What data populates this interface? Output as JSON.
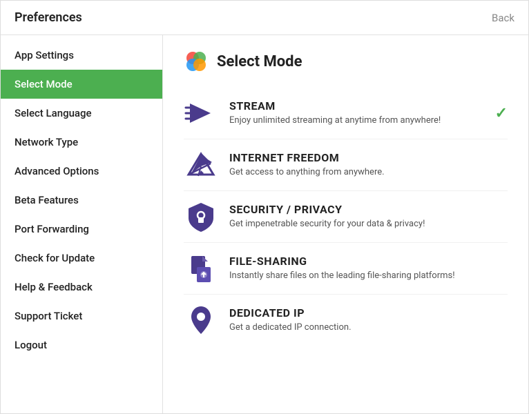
{
  "header": {
    "title": "Preferences",
    "back_label": "Back"
  },
  "sidebar": {
    "items": [
      {
        "id": "app-settings",
        "label": "App Settings",
        "active": false
      },
      {
        "id": "select-mode",
        "label": "Select Mode",
        "active": true
      },
      {
        "id": "select-language",
        "label": "Select Language",
        "active": false
      },
      {
        "id": "network-type",
        "label": "Network Type",
        "active": false
      },
      {
        "id": "advanced-options",
        "label": "Advanced Options",
        "active": false
      },
      {
        "id": "beta-features",
        "label": "Beta Features",
        "active": false
      },
      {
        "id": "port-forwarding",
        "label": "Port Forwarding",
        "active": false
      },
      {
        "id": "check-for-update",
        "label": "Check for Update",
        "active": false
      },
      {
        "id": "help-feedback",
        "label": "Help & Feedback",
        "active": false
      },
      {
        "id": "support-ticket",
        "label": "Support Ticket",
        "active": false
      },
      {
        "id": "logout",
        "label": "Logout",
        "active": false
      }
    ]
  },
  "main": {
    "title": "Select Mode",
    "modes": [
      {
        "id": "stream",
        "name": "STREAM",
        "description": "Enjoy unlimited streaming at anytime from anywhere!",
        "selected": true
      },
      {
        "id": "internet-freedom",
        "name": "INTERNET FREEDOM",
        "description": "Get access to anything from anywhere.",
        "selected": false
      },
      {
        "id": "security-privacy",
        "name": "SECURITY / PRIVACY",
        "description": "Get impenetrable security for your data & privacy!",
        "selected": false
      },
      {
        "id": "file-sharing",
        "name": "FILE-SHARING",
        "description": "Instantly share files on the leading file-sharing platforms!",
        "selected": false
      },
      {
        "id": "dedicated-ip",
        "name": "DEDICATED IP",
        "description": "Get a dedicated IP connection.",
        "selected": false
      }
    ]
  }
}
